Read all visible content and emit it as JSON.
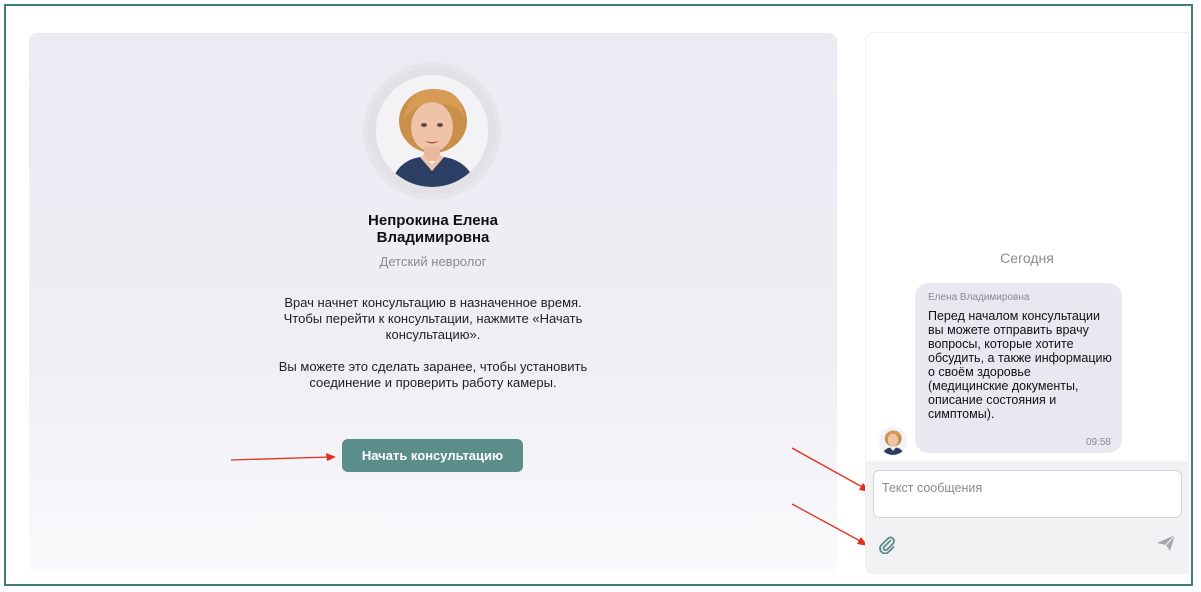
{
  "doctor": {
    "name_line1": "Непрокина Елена",
    "name_line2": "Владимировна",
    "specialty": "Детский невролог"
  },
  "consultation": {
    "info_paragraph1": "Врач начнет консультацию в назначенное время. Чтобы перейти к консультации, нажмите «Начать консультацию».",
    "info_paragraph2": "Вы можете это сделать заранее, чтобы установить соединение и проверить работу камеры.",
    "start_button_label": "Начать консультацию"
  },
  "chat": {
    "day_label": "Сегодня",
    "messages": [
      {
        "author": "Елена Владимировна",
        "text": "Перед началом консультации вы можете отправить врачу вопросы, которые хотите обсудить, а также информацию о своём здоровье (медицинские документы, описание состояния и симптомы).",
        "time": "09:58"
      }
    ],
    "input_placeholder": "Текст сообщения",
    "input_value": ""
  },
  "icons": {
    "attach": "paperclip-icon",
    "send": "send-icon"
  },
  "colors": {
    "accent": "#5b8d8b",
    "frame_border": "#3f7d7b",
    "annotation_arrow": "#e0301e",
    "bubble_bg": "#e8e8f1"
  }
}
